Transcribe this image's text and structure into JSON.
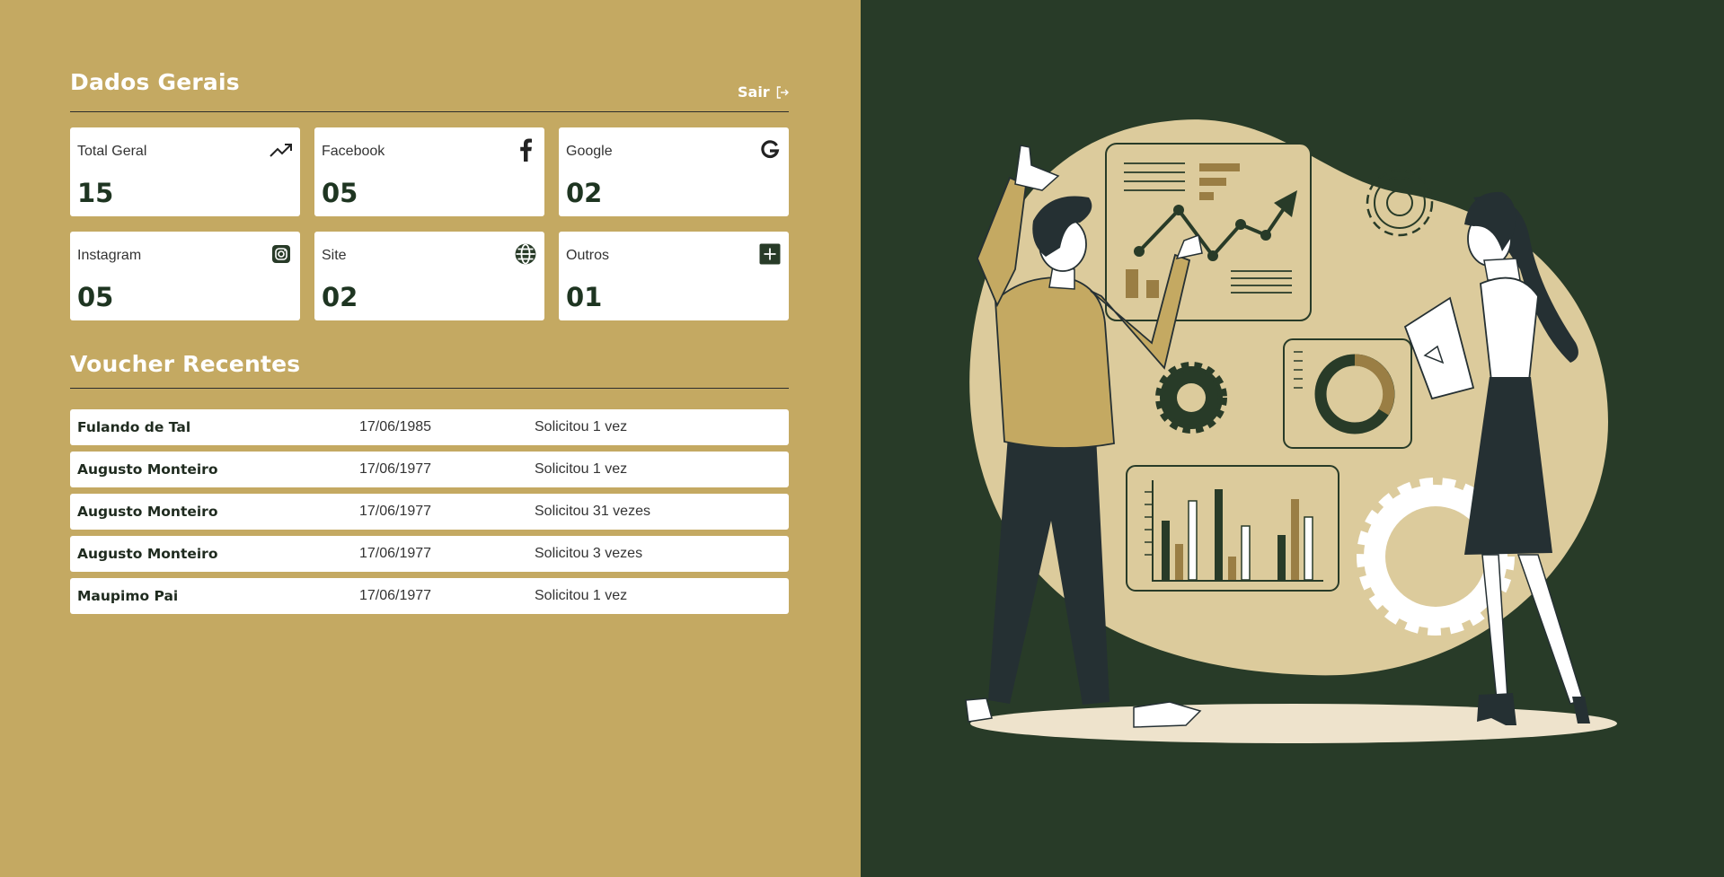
{
  "header": {
    "title": "Dados Gerais",
    "logout_label": "Sair"
  },
  "stats": [
    {
      "label": "Total Geral",
      "value": "15",
      "icon": "trending-up-icon"
    },
    {
      "label": "Facebook",
      "value": "05",
      "icon": "facebook-icon"
    },
    {
      "label": "Google",
      "value": "02",
      "icon": "google-icon"
    },
    {
      "label": "Instagram",
      "value": "05",
      "icon": "instagram-icon"
    },
    {
      "label": "Site",
      "value": "02",
      "icon": "globe-icon"
    },
    {
      "label": "Outros",
      "value": "01",
      "icon": "plus-square-icon"
    }
  ],
  "vouchers": {
    "title": "Voucher Recentes",
    "rows": [
      {
        "name": "Fulando de Tal",
        "date": "17/06/1985",
        "requests": "Solicitou 1 vez"
      },
      {
        "name": "Augusto Monteiro",
        "date": "17/06/1977",
        "requests": "Solicitou 1 vez"
      },
      {
        "name": "Augusto Monteiro",
        "date": "17/06/1977",
        "requests": "Solicitou 31 vezes"
      },
      {
        "name": "Augusto Monteiro",
        "date": "17/06/1977",
        "requests": "Solicitou 3 vezes"
      },
      {
        "name": "Maupimo Pai",
        "date": "17/06/1977",
        "requests": "Solicitou 1 vez"
      }
    ]
  },
  "colors": {
    "gold": "#c4a962",
    "dark_green": "#283b28",
    "card_bg": "#ffffff",
    "value_text": "#1e3521"
  }
}
